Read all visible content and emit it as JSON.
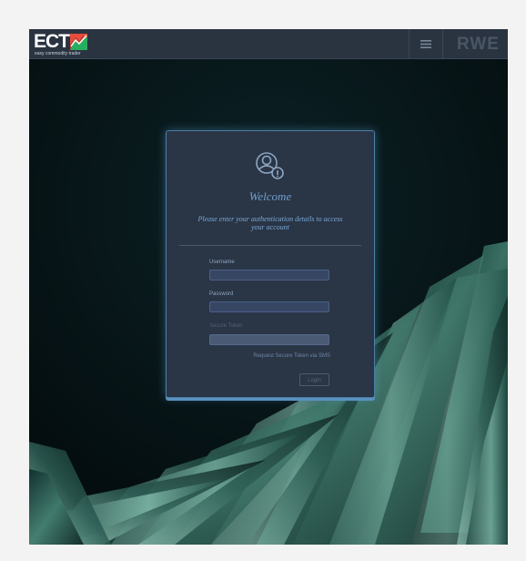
{
  "header": {
    "logo_text": "ECT",
    "logo_sub": "easy commodity trader",
    "brand": "RWE",
    "menu_icon": "hamburger-menu-icon"
  },
  "login": {
    "icon": "user-lock-icon",
    "title": "Welcome",
    "subtitle": "Please enter your authentication details to access your account",
    "username_label": "Username",
    "username_value": "",
    "password_label": "Password",
    "password_value": "",
    "token_label": "Secure Token",
    "token_value": "",
    "sms_link": "Request Secure Token via SMS",
    "login_button": "Login"
  },
  "colors": {
    "topbar": "#2a3441",
    "card": "#2a3545",
    "accent": "#6f9ed0",
    "background": "#071417"
  }
}
